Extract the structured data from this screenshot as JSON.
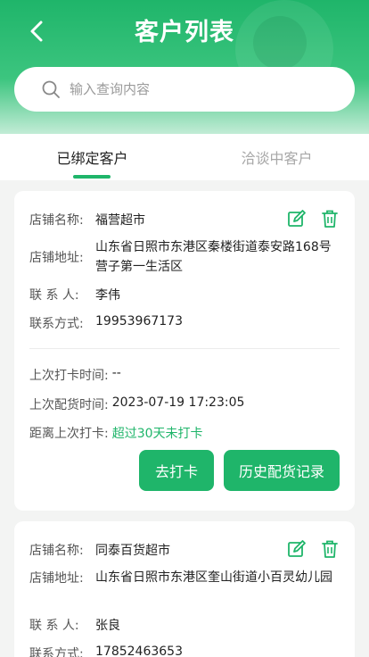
{
  "header": {
    "title": "客户列表"
  },
  "search": {
    "placeholder": "输入查询内容"
  },
  "tabs": [
    {
      "label": "已绑定客户",
      "active": true
    },
    {
      "label": "洽谈中客户",
      "active": false
    }
  ],
  "labels": {
    "store_name": "店铺名称:",
    "store_address": "店铺地址:",
    "contact": "联 系 人:",
    "phone": "联系方式:",
    "last_checkin": "上次打卡时间:",
    "last_delivery": "上次配货时间:",
    "since_checkin": "距离上次打卡:"
  },
  "customers": [
    {
      "store_name": "福营超市",
      "address": "山东省日照市东港区秦楼街道泰安路168号营子第一生活区",
      "contact": "李伟",
      "phone": "19953967173",
      "last_checkin": "--",
      "last_delivery": "2023-07-19 17:23:05",
      "since_checkin": "超过30天未打卡",
      "actions": {
        "checkin": "去打卡",
        "history": "历史配货记录"
      }
    },
    {
      "store_name": "同泰百货超市",
      "address": "山东省日照市东港区奎山街道小百灵幼儿园",
      "contact": "张良",
      "phone": "17852463653"
    }
  ],
  "colors": {
    "accent": "#1fb56a",
    "header_top": "#1fb56a"
  }
}
